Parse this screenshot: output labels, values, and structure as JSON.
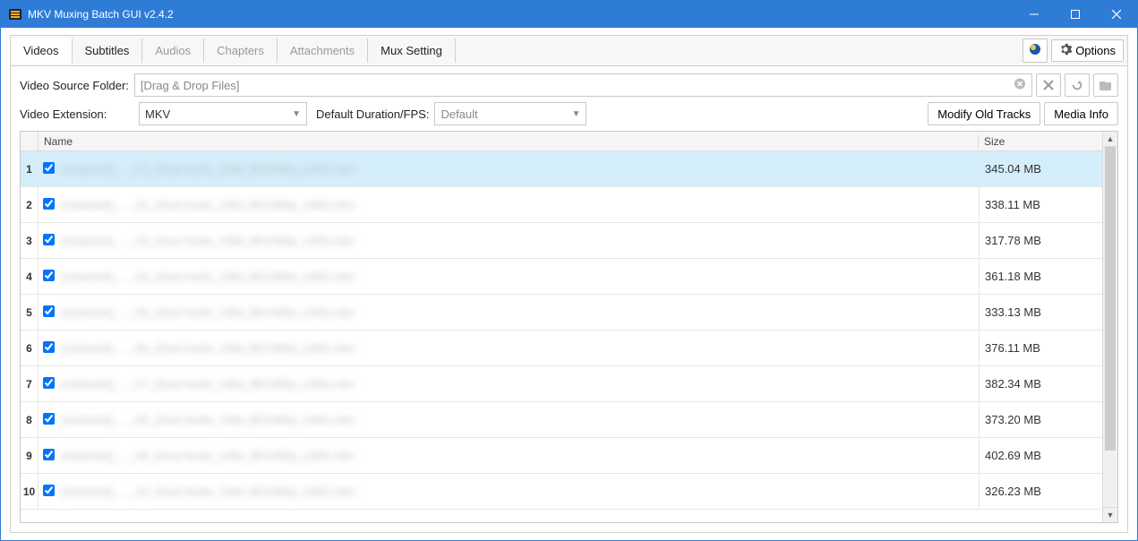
{
  "window": {
    "title": "MKV Muxing Batch GUI v2.4.2"
  },
  "tabs": [
    {
      "label": "Videos",
      "state": "active"
    },
    {
      "label": "Subtitles",
      "state": "enabled"
    },
    {
      "label": "Audios",
      "state": "disabled"
    },
    {
      "label": "Chapters",
      "state": "disabled"
    },
    {
      "label": "Attachments",
      "state": "disabled"
    },
    {
      "label": "Mux Setting",
      "state": "enabled"
    }
  ],
  "options_button": "Options",
  "source": {
    "label": "Video Source Folder:",
    "placeholder": "[Drag & Drop Files]"
  },
  "ext": {
    "label": "Video Extension:",
    "value": "MKV"
  },
  "duration": {
    "label": "Default Duration/FPS:",
    "value": "Default"
  },
  "buttons": {
    "modify": "Modify Old Tracks",
    "media_info": "Media Info"
  },
  "table": {
    "headers": {
      "name": "Name",
      "size": "Size"
    },
    "rows": [
      {
        "idx": "1",
        "checked": true,
        "name": "[redacted]_…_01_(Dual Audio_10bit_BD1080p_x265).mkv",
        "size": "345.04 MB",
        "selected": true
      },
      {
        "idx": "2",
        "checked": true,
        "name": "[redacted]_…_02_(Dual Audio_10bit_BD1080p_x265).mkv",
        "size": "338.11 MB",
        "selected": false
      },
      {
        "idx": "3",
        "checked": true,
        "name": "[redacted]_…_03_(Dual Audio_10bit_BD1080p_x265).mkv",
        "size": "317.78 MB",
        "selected": false
      },
      {
        "idx": "4",
        "checked": true,
        "name": "[redacted]_…_04_(Dual Audio_10bit_BD1080p_x265).mkv",
        "size": "361.18 MB",
        "selected": false
      },
      {
        "idx": "5",
        "checked": true,
        "name": "[redacted]_…_05_(Dual Audio_10bit_BD1080p_x265).mkv",
        "size": "333.13 MB",
        "selected": false
      },
      {
        "idx": "6",
        "checked": true,
        "name": "[redacted]_…_06_(Dual Audio_10bit_BD1080p_x265).mkv",
        "size": "376.11 MB",
        "selected": false
      },
      {
        "idx": "7",
        "checked": true,
        "name": "[redacted]_…_07_(Dual Audio_10bit_BD1080p_x265).mkv",
        "size": "382.34 MB",
        "selected": false
      },
      {
        "idx": "8",
        "checked": true,
        "name": "[redacted]_…_08_(Dual Audio_10bit_BD1080p_x265).mkv",
        "size": "373.20 MB",
        "selected": false
      },
      {
        "idx": "9",
        "checked": true,
        "name": "[redacted]_…_09_(Dual Audio_10bit_BD1080p_x265).mkv",
        "size": "402.69 MB",
        "selected": false
      },
      {
        "idx": "10",
        "checked": true,
        "name": "[redacted]_…_10_(Dual Audio_10bit_BD1080p_x265).mkv",
        "size": "326.23 MB",
        "selected": false
      }
    ]
  }
}
